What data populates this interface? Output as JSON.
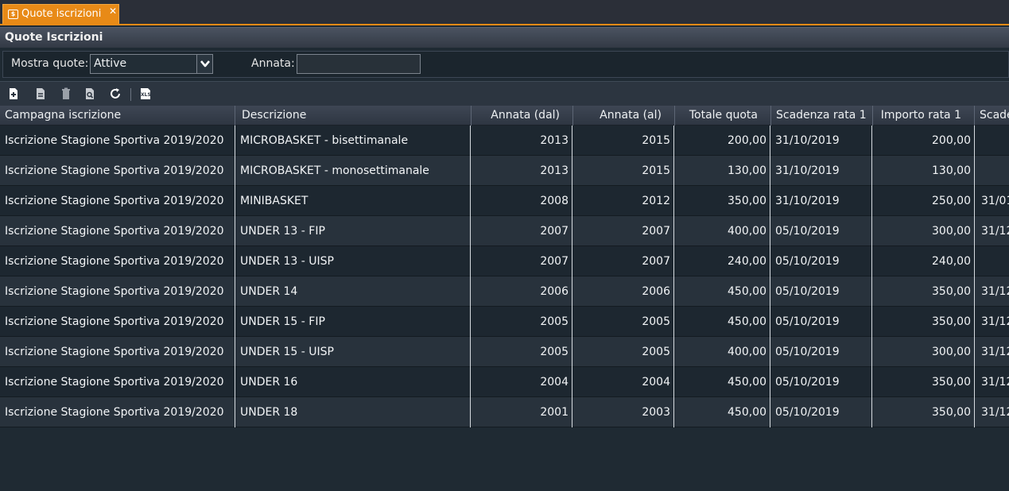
{
  "tab": {
    "title": "Quote iscrizioni",
    "close": "✕",
    "icon_text": "$"
  },
  "panel": {
    "title": "Quote Iscrizioni"
  },
  "filters": {
    "mostra_label": "Mostra quote:",
    "mostra_value": "Attive",
    "annata_label": "Annata:",
    "annata_value": ""
  },
  "toolbar": {
    "buttons": [
      "new-icon",
      "edit-icon",
      "delete-icon",
      "preview-icon",
      "refresh-icon",
      "export-xls-icon"
    ],
    "xls_text": "XLS"
  },
  "colors": {
    "accent": "#e88a17",
    "row_odd": "#28323c",
    "row_even": "#1d2730"
  },
  "columns": [
    "Campagna iscrizione",
    "Descrizione",
    "Annata (dal)",
    "Annata (al)",
    "Totale quota",
    "Scadenza rata 1",
    "Importo rata 1",
    "Scade"
  ],
  "rows": [
    [
      "Iscrizione Stagione Sportiva 2019/2020",
      "MICROBASKET - bisettimanale",
      "2013",
      "2015",
      "200,00",
      "31/10/2019",
      "200,00",
      ""
    ],
    [
      "Iscrizione Stagione Sportiva 2019/2020",
      "MICROBASKET - monosettimanale",
      "2013",
      "2015",
      "130,00",
      "31/10/2019",
      "130,00",
      ""
    ],
    [
      "Iscrizione Stagione Sportiva 2019/2020",
      "MINIBASKET",
      "2008",
      "2012",
      "350,00",
      "31/10/2019",
      "250,00",
      "31/01/"
    ],
    [
      "Iscrizione Stagione Sportiva 2019/2020",
      "UNDER 13 - FIP",
      "2007",
      "2007",
      "400,00",
      "05/10/2019",
      "300,00",
      "31/12/"
    ],
    [
      "Iscrizione Stagione Sportiva 2019/2020",
      "UNDER 13 - UISP",
      "2007",
      "2007",
      "240,00",
      "05/10/2019",
      "240,00",
      ""
    ],
    [
      "Iscrizione Stagione Sportiva 2019/2020",
      "UNDER 14",
      "2006",
      "2006",
      "450,00",
      "05/10/2019",
      "350,00",
      "31/12/"
    ],
    [
      "Iscrizione Stagione Sportiva 2019/2020",
      "UNDER 15 - FIP",
      "2005",
      "2005",
      "450,00",
      "05/10/2019",
      "350,00",
      "31/12/"
    ],
    [
      "Iscrizione Stagione Sportiva 2019/2020",
      "UNDER 15 - UISP",
      "2005",
      "2005",
      "400,00",
      "05/10/2019",
      "300,00",
      "31/12/"
    ],
    [
      "Iscrizione Stagione Sportiva 2019/2020",
      "UNDER 16",
      "2004",
      "2004",
      "450,00",
      "05/10/2019",
      "350,00",
      "31/12/"
    ],
    [
      "Iscrizione Stagione Sportiva 2019/2020",
      "UNDER 18",
      "2001",
      "2003",
      "450,00",
      "05/10/2019",
      "350,00",
      "31/12/"
    ]
  ]
}
